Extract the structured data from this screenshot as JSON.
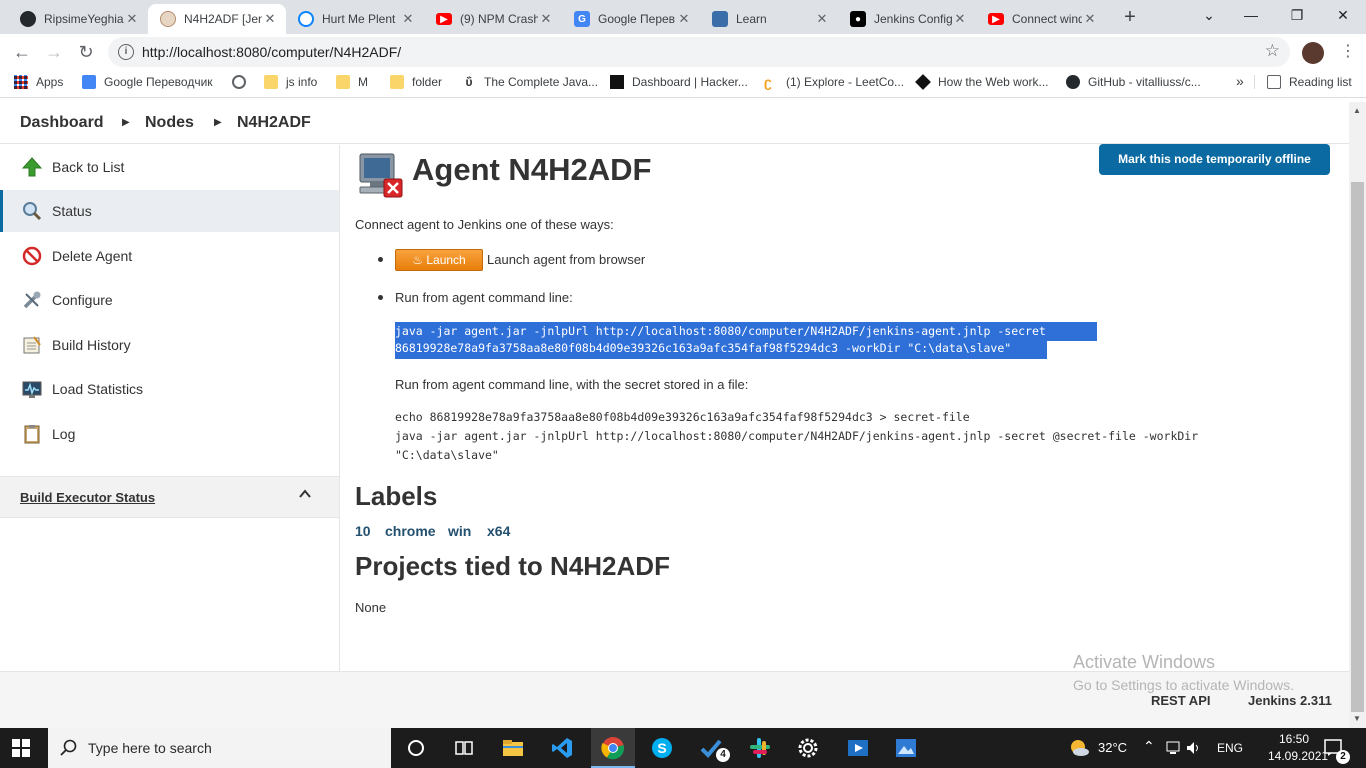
{
  "browser": {
    "tabs": [
      {
        "title": "RipsimeYeghia",
        "icon": "github-icon",
        "color": "#24292e"
      },
      {
        "title": "N4H2ADF [Jen",
        "icon": "jenkins-icon",
        "color": "#d33833",
        "active": true
      },
      {
        "title": "Hurt Me Plent",
        "icon": "circle-icon",
        "color": "#0a84ff"
      },
      {
        "title": "(9) NPM Crash",
        "icon": "youtube-icon",
        "color": "#ff0000"
      },
      {
        "title": "Google Перев",
        "icon": "translate-icon",
        "color": "#4285f4"
      },
      {
        "title": "Learn",
        "icon": "learn-icon",
        "color": "#3b6ea8"
      },
      {
        "title": "Jenkins Config",
        "icon": "medium-icon",
        "color": "#000000"
      },
      {
        "title": "Connect wind",
        "icon": "youtube-icon",
        "color": "#ff0000"
      }
    ],
    "url": "http://localhost:8080/computer/N4H2ADF/",
    "bookmarks": [
      {
        "label": "Apps",
        "icon": "apps-grid-icon"
      },
      {
        "label": "Google Переводчик",
        "icon": "translate-icon"
      },
      {
        "label": "",
        "icon": "globe-icon"
      },
      {
        "label": "js info",
        "icon": "folder-icon"
      },
      {
        "label": "M",
        "icon": "folder-icon"
      },
      {
        "label": "folder",
        "icon": "folder-icon"
      },
      {
        "label": "The Complete Java...",
        "icon": "udemy-icon"
      },
      {
        "label": "Dashboard | Hacker...",
        "icon": "hackerrank-icon"
      },
      {
        "label": "(1) Explore - LeetCo...",
        "icon": "leetcode-icon"
      },
      {
        "label": "How the Web work...",
        "icon": "web-icon"
      },
      {
        "label": "GitHub - vitalliuss/c...",
        "icon": "github-icon"
      }
    ],
    "bookmarks_more": "»",
    "reading_list": "Reading list"
  },
  "breadcrumb": {
    "items": [
      "Dashboard",
      "Nodes",
      "N4H2ADF"
    ]
  },
  "sidebar": {
    "items": [
      {
        "label": "Back to List",
        "icon": "up-arrow-icon"
      },
      {
        "label": "Status",
        "icon": "search-icon",
        "active": true
      },
      {
        "label": "Delete Agent",
        "icon": "no-entry-icon"
      },
      {
        "label": "Configure",
        "icon": "wrench-icon"
      },
      {
        "label": "Build History",
        "icon": "notepad-icon"
      },
      {
        "label": "Load Statistics",
        "icon": "monitor-graph-icon"
      },
      {
        "label": "Log",
        "icon": "clipboard-icon"
      }
    ],
    "executor_title": "Build Executor Status"
  },
  "main": {
    "offline_button": "Mark this node temporarily offline",
    "title": "Agent N4H2ADF",
    "connect_intro": "Connect agent to Jenkins one of these ways:",
    "launch_button": "Launch",
    "launch_text": "Launch agent from browser",
    "cmdline_text": "Run from agent command line:",
    "cmd1_line1": "java -jar agent.jar -jnlpUrl http://localhost:8080/computer/N4H2ADF/jenkins-agent.jnlp -secret",
    "cmd1_line2": "86819928e78a9fa3758aa8e80f08b4d09e39326c163a9afc354faf98f5294dc3 -workDir \"C:\\data\\slave\"",
    "cmdfile_text": "Run from agent command line, with the secret stored in a file:",
    "cmd2_line1": "echo 86819928e78a9fa3758aa8e80f08b4d09e39326c163a9afc354faf98f5294dc3 > secret-file",
    "cmd2_line2": "java -jar agent.jar -jnlpUrl http://localhost:8080/computer/N4H2ADF/jenkins-agent.jnlp -secret @secret-file -workDir",
    "cmd2_line3": "\"C:\\data\\slave\"",
    "labels_heading": "Labels",
    "labels": [
      "10",
      "chrome",
      "win",
      "x64"
    ],
    "projects_heading": "Projects tied to N4H2ADF",
    "projects_value": "None"
  },
  "footer": {
    "rest_api": "REST API",
    "version": "Jenkins 2.311",
    "watermark_title": "Activate Windows",
    "watermark_sub": "Go to Settings to activate Windows."
  },
  "taskbar": {
    "search_placeholder": "Type here to search",
    "temperature": "32°C",
    "language": "ENG",
    "time": "16:50",
    "date": "14.09.2021",
    "notifications": "2",
    "todo_badge": "4"
  },
  "colors": {
    "jenkins_blue": "#0b6aa2",
    "link": "#24506f",
    "selection": "#2f6fd8",
    "launch_orange": "#f39c2a"
  }
}
